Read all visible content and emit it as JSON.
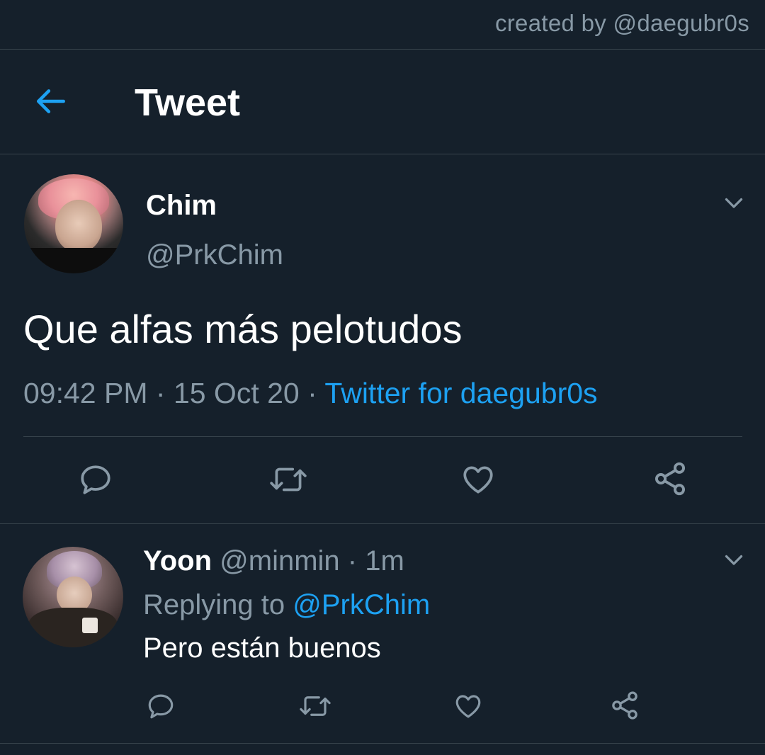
{
  "credit": "created by @daegubr0s",
  "header": {
    "title": "Tweet"
  },
  "tweet": {
    "author_name": "Chim",
    "author_handle": "@PrkChim",
    "text": "Que alfas más pelotudos",
    "time": "09:42 PM",
    "date": "15 Oct 20",
    "separator": " · ",
    "source": "Twitter for daegubr0s"
  },
  "reply": {
    "author_name": "Yoon",
    "author_handle": "@minmin",
    "time": "1m",
    "separator": " · ",
    "replying_label": "Replying to ",
    "replying_to": "@PrkChim",
    "text": "Pero están buenos"
  },
  "icons": {
    "back": "arrow-left-icon",
    "more": "chevron-down-icon",
    "reply": "speech-bubble-icon",
    "retweet": "retweet-icon",
    "like": "heart-icon",
    "share": "share-icon"
  },
  "colors": {
    "background": "#15202b",
    "accent": "#1da1f2",
    "secondary_text": "#8899a6",
    "divider": "#38444d",
    "primary_text": "#ffffff"
  }
}
